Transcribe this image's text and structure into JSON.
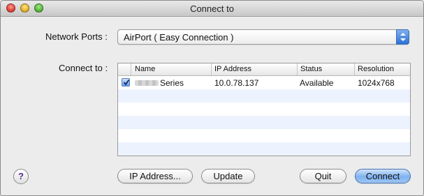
{
  "window": {
    "title": "Connect to"
  },
  "form": {
    "network_ports_label": "Network Ports :",
    "network_ports_value": "AirPort ( Easy Connection )",
    "connect_to_label": "Connect to :"
  },
  "table": {
    "columns": [
      "Name",
      "IP Address",
      "Status",
      "Resolution"
    ],
    "rows": [
      {
        "checked": true,
        "name": "Series",
        "ip": "10.0.78.137",
        "status": "Available",
        "resolution": "1024x768"
      }
    ]
  },
  "buttons": {
    "help": "?",
    "ip_address": "IP Address...",
    "update": "Update",
    "quit": "Quit",
    "connect": "Connect"
  },
  "colors": {
    "accent": "#3a7fe0",
    "row_stripe": "#edf3fe"
  }
}
